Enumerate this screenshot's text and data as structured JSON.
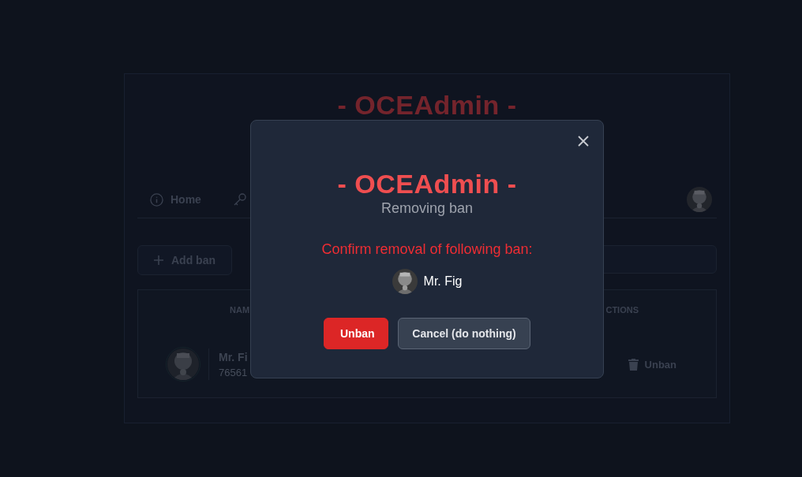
{
  "background_page": {
    "title": "- OCEAdmin -",
    "nav": [
      {
        "label": "Home"
      }
    ],
    "add_button": "Add ban",
    "table": {
      "columns": [
        "NAM",
        "CTIONS"
      ],
      "rows": [
        {
          "name": "Mr. Fi",
          "steam_id": "76561",
          "action": "Unban"
        }
      ]
    }
  },
  "modal": {
    "title": "- OCEAdmin -",
    "subtitle": "Removing ban",
    "message": "Confirm removal of following ban:",
    "player": "Mr. Fig",
    "buttons": [
      {
        "label": "Unban",
        "kind": "danger"
      },
      {
        "label": "Cancel (do nothing)",
        "kind": "secondary"
      }
    ]
  }
}
